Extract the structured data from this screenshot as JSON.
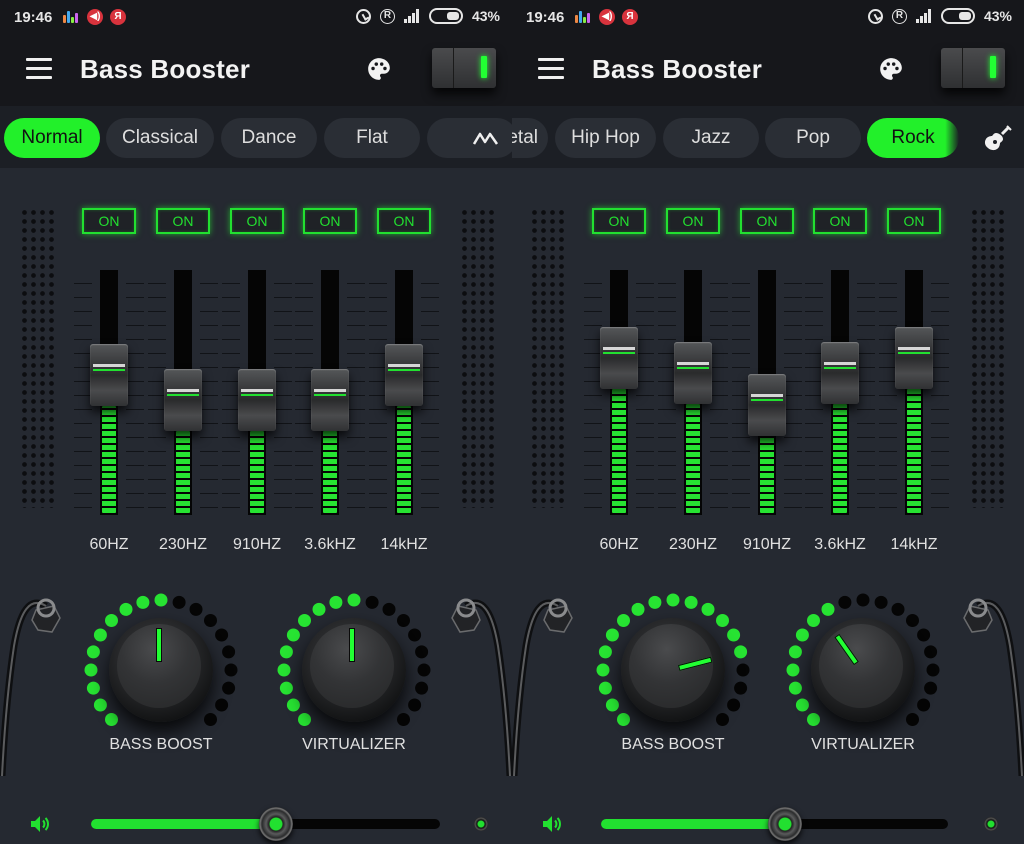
{
  "theme": {
    "accent": "#22f02a",
    "panel_bg": "#252931",
    "bar_bg": "#16171b"
  },
  "screens": [
    {
      "status_bar": {
        "time": "19:46",
        "battery": "43%",
        "icons": [
          "equalizer-notif-icon",
          "sound-notif-icon",
          "yandex-notif-icon",
          "alarm-icon",
          "roaming-icon",
          "signal-icon",
          "battery-icon"
        ],
        "notif_letter": "Я"
      },
      "app_bar": {
        "title": "Bass Booster",
        "menu_icon": "hamburger-menu-icon",
        "palette_icon": "palette-icon",
        "power_switch_on": true
      },
      "presets": {
        "visible": [
          "Normal",
          "Classical",
          "Dance",
          "Flat",
          ""
        ],
        "selected": "Normal",
        "trailing_icon": "custom-wave-icon"
      },
      "equalizer": {
        "bands": [
          {
            "label": "60HZ",
            "on_label": "ON",
            "level": 0.57
          },
          {
            "label": "230HZ",
            "on_label": "ON",
            "level": 0.47
          },
          {
            "label": "910HZ",
            "on_label": "ON",
            "level": 0.47
          },
          {
            "label": "3.6kHZ",
            "on_label": "ON",
            "level": 0.47
          },
          {
            "label": "14kHZ",
            "on_label": "ON",
            "level": 0.57
          }
        ]
      },
      "knobs": [
        {
          "label": "BASS BOOST",
          "value": 0.5
        },
        {
          "label": "VIRTUALIZER",
          "value": 0.5
        }
      ],
      "volume": {
        "value": 0.53,
        "icon": "speaker-icon"
      }
    },
    {
      "status_bar": {
        "time": "19:46",
        "battery": "43%",
        "icons": [
          "equalizer-notif-icon",
          "sound-notif-icon",
          "yandex-notif-icon",
          "alarm-icon",
          "roaming-icon",
          "signal-icon",
          "battery-icon"
        ],
        "notif_letter": "Я"
      },
      "app_bar": {
        "title": "Bass Booster",
        "menu_icon": "hamburger-menu-icon",
        "palette_icon": "palette-icon",
        "power_switch_on": true
      },
      "presets": {
        "visible": [
          "Metal",
          "Hip Hop",
          "Jazz",
          "Pop",
          "Rock"
        ],
        "partial_first_text": "etal",
        "selected": "Rock",
        "trailing_icon": "guitar-icon"
      },
      "equalizer": {
        "bands": [
          {
            "label": "60HZ",
            "on_label": "ON",
            "level": 0.64
          },
          {
            "label": "230HZ",
            "on_label": "ON",
            "level": 0.58
          },
          {
            "label": "910HZ",
            "on_label": "ON",
            "level": 0.45
          },
          {
            "label": "3.6kHZ",
            "on_label": "ON",
            "level": 0.58
          },
          {
            "label": "14kHZ",
            "on_label": "ON",
            "level": 0.64
          }
        ]
      },
      "knobs": [
        {
          "label": "BASS BOOST",
          "value": 0.78
        },
        {
          "label": "VIRTUALIZER",
          "value": 0.37
        }
      ],
      "volume": {
        "value": 0.53,
        "icon": "speaker-icon"
      }
    }
  ]
}
